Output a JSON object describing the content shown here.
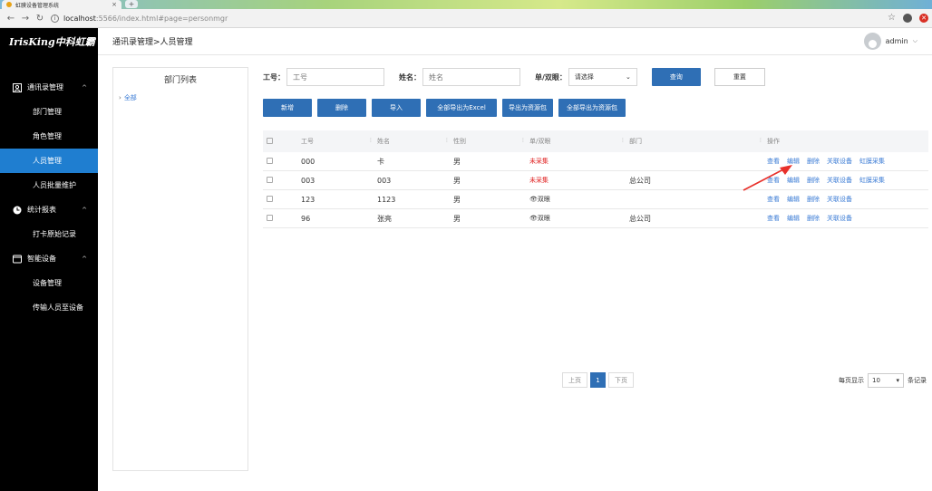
{
  "browser": {
    "tab_title": "虹膜设备管理系统",
    "url_host": "localhost",
    "url_path": ":5566/index.html#page=personmgr"
  },
  "sidebar": {
    "logo": "IrisKing中科虹霸",
    "groups": [
      {
        "label": "通讯录管理",
        "icon": "contacts-icon",
        "items": [
          "部门管理",
          "角色管理",
          "人员管理",
          "人员批量维护"
        ]
      },
      {
        "label": "统计报表",
        "icon": "clock-icon",
        "items": [
          "打卡原始记录"
        ]
      },
      {
        "label": "智能设备",
        "icon": "device-icon",
        "items": [
          "设备管理",
          "传输人员至设备"
        ]
      }
    ],
    "active_item": "人员管理"
  },
  "header": {
    "breadcrumb": "通讯录管理>人员管理",
    "username": "admin"
  },
  "dept": {
    "title": "部门列表",
    "root": "全部"
  },
  "search": {
    "id_label": "工号：",
    "id_placeholder": "工号",
    "name_label": "姓名：",
    "name_placeholder": "姓名",
    "mode_label": "单/双眼：",
    "mode_value": "请选择",
    "query": "查询",
    "reset": "重置"
  },
  "actions": [
    "新增",
    "删除",
    "导入",
    "全部导出为Excel",
    "导出为资源包",
    "全部导出为资源包"
  ],
  "table": {
    "headers": [
      "工号",
      "姓名",
      "性别",
      "单/双眼",
      "部门",
      "操作"
    ],
    "rows": [
      {
        "id": "000",
        "name": "卡",
        "gender": "男",
        "eye": "未采集",
        "dept": "",
        "ops": [
          "查看",
          "编辑",
          "删除",
          "关联设备",
          "虹膜采集"
        ]
      },
      {
        "id": "003",
        "name": "003",
        "gender": "男",
        "eye": "未采集",
        "dept": "总公司",
        "ops": [
          "查看",
          "编辑",
          "删除",
          "关联设备",
          "虹膜采集"
        ]
      },
      {
        "id": "123",
        "name": "1123",
        "gender": "男",
        "eye": "👁双眼",
        "dept": "",
        "ops": [
          "查看",
          "编辑",
          "删除",
          "关联设备"
        ]
      },
      {
        "id": "96",
        "name": "张亮",
        "gender": "男",
        "eye": "👁双眼",
        "dept": "总公司",
        "ops": [
          "查看",
          "编辑",
          "删除",
          "关联设备"
        ]
      }
    ]
  },
  "pager": {
    "prev": "上页",
    "current": "1",
    "next": "下页",
    "per_page_label": "每页显示",
    "per_page": "10",
    "unit": "条记录"
  },
  "colors": {
    "primary": "#2f6fb5",
    "sidebar_active": "#1f7ed0",
    "warn": "#e02020"
  }
}
